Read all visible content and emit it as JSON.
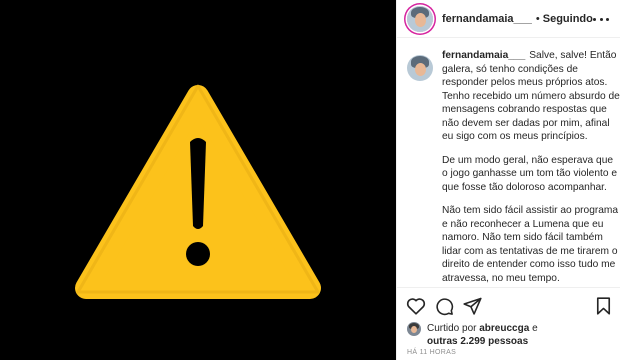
{
  "header": {
    "username": "fernandamaia___",
    "separator": "•",
    "follow_label": "Seguindo"
  },
  "caption": {
    "username": "fernandamaia___",
    "paragraphs": [
      "Salve, salve! Então galera, só tenho condições de responder pelos meus próprios atos. Tenho recebido um número absurdo de mensagens cobrando respostas que não devem ser dadas por mim, afinal eu sigo com os meus princípios.",
      "De um modo geral, não esperava que o jogo ganhasse um tom tão violento e que fosse tão doloroso acompanhar.",
      "Não tem sido fácil assistir ao programa e não reconhecer a Lumena que eu namoro. Não tem sido fácil também lidar com as tentativas de me tirarem o direito de entender como isso tudo me atravessa, no meu tempo."
    ]
  },
  "likes": {
    "prefix": "Curtido por",
    "user": "abreuccga",
    "connector": "e",
    "others": "outras 2.299 pessoas"
  },
  "timestamp": "HÁ 11 HORAS",
  "media": {
    "icon": "warning-icon",
    "fill": "#fcc21b",
    "stroke": "#e3a913",
    "symbol": "!"
  },
  "icons": [
    "more-options-icon",
    "heart-icon",
    "comment-icon",
    "share-icon",
    "bookmark-icon"
  ]
}
